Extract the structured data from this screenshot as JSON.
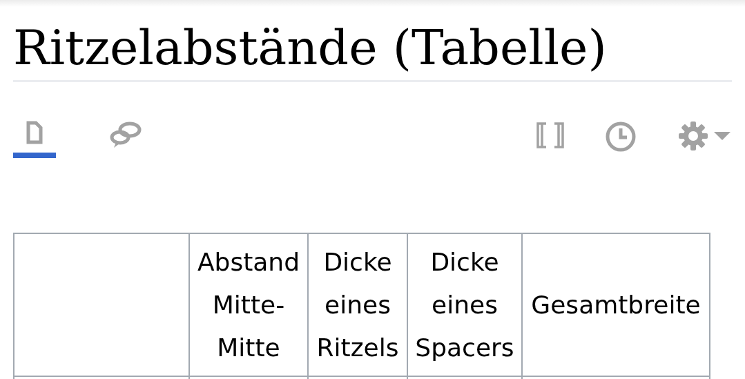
{
  "title": "Ritzelabstände (Tabelle)",
  "tabs": [
    {
      "kind": "article",
      "selected": true
    },
    {
      "kind": "talk",
      "selected": false
    }
  ],
  "actions": [
    {
      "kind": "brackets"
    },
    {
      "kind": "history"
    },
    {
      "kind": "settings"
    }
  ],
  "table": {
    "columns": [
      "",
      "Abstand Mitte-Mitte",
      "Dicke eines Ritzels",
      "Dicke eines Spacers",
      "Gesamtbreite"
    ]
  }
}
